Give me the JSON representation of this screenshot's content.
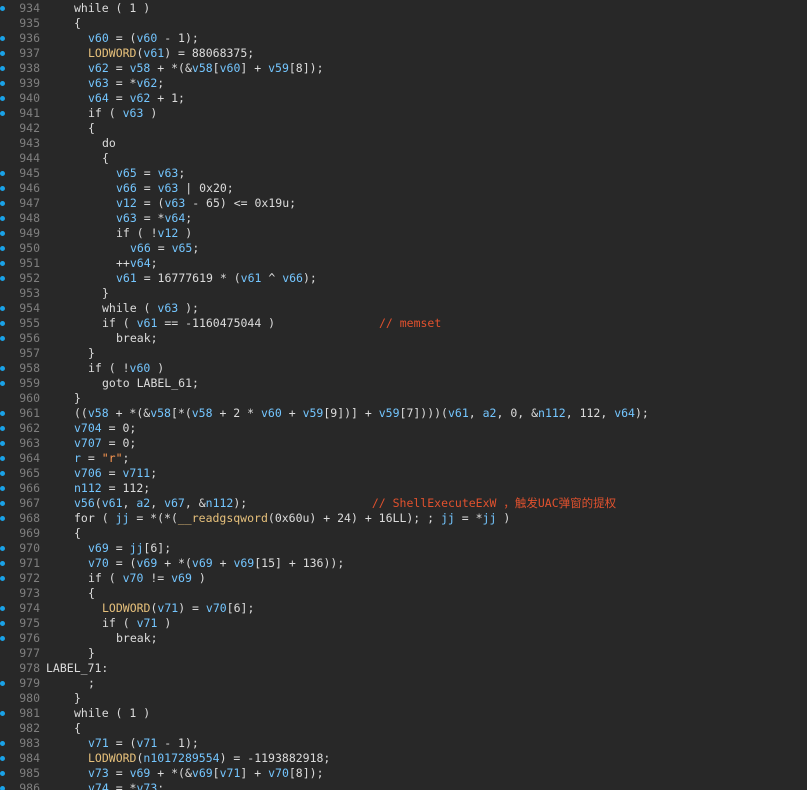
{
  "editor": {
    "lines": [
      {
        "n": "934",
        "dot": true,
        "indent": 2,
        "tokens": [
          [
            "k",
            "while ( 1 )"
          ]
        ]
      },
      {
        "n": "935",
        "dot": false,
        "indent": 2,
        "tokens": [
          [
            "k",
            "{"
          ]
        ]
      },
      {
        "n": "936",
        "dot": true,
        "indent": 3,
        "tokens": [
          [
            "v",
            "v60"
          ],
          [
            "k",
            " = ("
          ],
          [
            "v",
            "v60"
          ],
          [
            "k",
            " - 1);"
          ]
        ]
      },
      {
        "n": "937",
        "dot": true,
        "indent": 3,
        "tokens": [
          [
            "m",
            "LODWORD"
          ],
          [
            "k",
            "("
          ],
          [
            "v",
            "v61"
          ],
          [
            "k",
            ") = 88068375;"
          ]
        ]
      },
      {
        "n": "938",
        "dot": true,
        "indent": 3,
        "tokens": [
          [
            "v",
            "v62"
          ],
          [
            "k",
            " = "
          ],
          [
            "v",
            "v58"
          ],
          [
            "k",
            " + *(&"
          ],
          [
            "v",
            "v58"
          ],
          [
            "k",
            "["
          ],
          [
            "v",
            "v60"
          ],
          [
            "k",
            "] + "
          ],
          [
            "v",
            "v59"
          ],
          [
            "k",
            "[8]);"
          ]
        ]
      },
      {
        "n": "939",
        "dot": true,
        "indent": 3,
        "tokens": [
          [
            "v",
            "v63"
          ],
          [
            "k",
            " = *"
          ],
          [
            "v",
            "v62"
          ],
          [
            "k",
            ";"
          ]
        ]
      },
      {
        "n": "940",
        "dot": true,
        "indent": 3,
        "tokens": [
          [
            "v",
            "v64"
          ],
          [
            "k",
            " = "
          ],
          [
            "v",
            "v62"
          ],
          [
            "k",
            " + 1;"
          ]
        ]
      },
      {
        "n": "941",
        "dot": true,
        "indent": 3,
        "tokens": [
          [
            "k",
            "if ( "
          ],
          [
            "v",
            "v63"
          ],
          [
            "k",
            " )"
          ]
        ]
      },
      {
        "n": "942",
        "dot": false,
        "indent": 3,
        "tokens": [
          [
            "k",
            "{"
          ]
        ]
      },
      {
        "n": "943",
        "dot": false,
        "indent": 4,
        "tokens": [
          [
            "k",
            "do"
          ]
        ]
      },
      {
        "n": "944",
        "dot": false,
        "indent": 4,
        "tokens": [
          [
            "k",
            "{"
          ]
        ]
      },
      {
        "n": "945",
        "dot": true,
        "indent": 5,
        "tokens": [
          [
            "v",
            "v65"
          ],
          [
            "k",
            " = "
          ],
          [
            "v",
            "v63"
          ],
          [
            "k",
            ";"
          ]
        ]
      },
      {
        "n": "946",
        "dot": true,
        "indent": 5,
        "tokens": [
          [
            "v",
            "v66"
          ],
          [
            "k",
            " = "
          ],
          [
            "v",
            "v63"
          ],
          [
            "k",
            " | 0x20;"
          ]
        ]
      },
      {
        "n": "947",
        "dot": true,
        "indent": 5,
        "tokens": [
          [
            "v",
            "v12"
          ],
          [
            "k",
            " = ("
          ],
          [
            "v",
            "v63"
          ],
          [
            "k",
            " - 65) <= 0x19u;"
          ]
        ]
      },
      {
        "n": "948",
        "dot": true,
        "indent": 5,
        "tokens": [
          [
            "v",
            "v63"
          ],
          [
            "k",
            " = *"
          ],
          [
            "v",
            "v64"
          ],
          [
            "k",
            ";"
          ]
        ]
      },
      {
        "n": "949",
        "dot": true,
        "indent": 5,
        "tokens": [
          [
            "k",
            "if ( !"
          ],
          [
            "v",
            "v12"
          ],
          [
            "k",
            " )"
          ]
        ]
      },
      {
        "n": "950",
        "dot": true,
        "indent": 6,
        "tokens": [
          [
            "v",
            "v66"
          ],
          [
            "k",
            " = "
          ],
          [
            "v",
            "v65"
          ],
          [
            "k",
            ";"
          ]
        ]
      },
      {
        "n": "951",
        "dot": true,
        "indent": 5,
        "tokens": [
          [
            "k",
            "++"
          ],
          [
            "v",
            "v64"
          ],
          [
            "k",
            ";"
          ]
        ]
      },
      {
        "n": "952",
        "dot": true,
        "indent": 5,
        "tokens": [
          [
            "v",
            "v61"
          ],
          [
            "k",
            " = 16777619 * ("
          ],
          [
            "v",
            "v61"
          ],
          [
            "k",
            " ^ "
          ],
          [
            "v",
            "v66"
          ],
          [
            "k",
            ");"
          ]
        ]
      },
      {
        "n": "953",
        "dot": false,
        "indent": 4,
        "tokens": [
          [
            "k",
            "}"
          ]
        ]
      },
      {
        "n": "954",
        "dot": true,
        "indent": 4,
        "tokens": [
          [
            "k",
            "while ( "
          ],
          [
            "v",
            "v63"
          ],
          [
            "k",
            " );"
          ]
        ]
      },
      {
        "n": "955",
        "dot": true,
        "indent": 4,
        "tokens": [
          [
            "k",
            "if ( "
          ],
          [
            "v",
            "v61"
          ],
          [
            "k",
            " == -1160475044 )               "
          ],
          [
            "c",
            "// memset"
          ]
        ]
      },
      {
        "n": "956",
        "dot": true,
        "indent": 5,
        "tokens": [
          [
            "k",
            "break;"
          ]
        ]
      },
      {
        "n": "957",
        "dot": false,
        "indent": 3,
        "tokens": [
          [
            "k",
            "}"
          ]
        ]
      },
      {
        "n": "958",
        "dot": true,
        "indent": 3,
        "tokens": [
          [
            "k",
            "if ( !"
          ],
          [
            "v",
            "v60"
          ],
          [
            "k",
            " )"
          ]
        ]
      },
      {
        "n": "959",
        "dot": true,
        "indent": 4,
        "tokens": [
          [
            "k",
            "goto LABEL_61;"
          ]
        ]
      },
      {
        "n": "960",
        "dot": false,
        "indent": 2,
        "tokens": [
          [
            "k",
            "}"
          ]
        ]
      },
      {
        "n": "961",
        "dot": true,
        "indent": 2,
        "tokens": [
          [
            "k",
            "(("
          ],
          [
            "v",
            "v58"
          ],
          [
            "k",
            " + *(&"
          ],
          [
            "v",
            "v58"
          ],
          [
            "k",
            "[*("
          ],
          [
            "v",
            "v58"
          ],
          [
            "k",
            " + 2 * "
          ],
          [
            "v",
            "v60"
          ],
          [
            "k",
            " + "
          ],
          [
            "v",
            "v59"
          ],
          [
            "k",
            "[9])] + "
          ],
          [
            "v",
            "v59"
          ],
          [
            "k",
            "[7])))("
          ],
          [
            "v",
            "v61"
          ],
          [
            "k",
            ", "
          ],
          [
            "v",
            "a2"
          ],
          [
            "k",
            ", 0, &"
          ],
          [
            "v",
            "n112"
          ],
          [
            "k",
            ", 112, "
          ],
          [
            "v",
            "v64"
          ],
          [
            "k",
            ");"
          ]
        ]
      },
      {
        "n": "962",
        "dot": true,
        "indent": 2,
        "tokens": [
          [
            "v",
            "v704"
          ],
          [
            "k",
            " = 0;"
          ]
        ]
      },
      {
        "n": "963",
        "dot": true,
        "indent": 2,
        "tokens": [
          [
            "v",
            "v707"
          ],
          [
            "k",
            " = 0;"
          ]
        ]
      },
      {
        "n": "964",
        "dot": true,
        "indent": 2,
        "tokens": [
          [
            "v",
            "r"
          ],
          [
            "k",
            " = "
          ],
          [
            "s",
            "\"r\""
          ],
          [
            "k",
            ";"
          ]
        ]
      },
      {
        "n": "965",
        "dot": true,
        "indent": 2,
        "tokens": [
          [
            "v",
            "v706"
          ],
          [
            "k",
            " = "
          ],
          [
            "v",
            "v711"
          ],
          [
            "k",
            ";"
          ]
        ]
      },
      {
        "n": "966",
        "dot": true,
        "indent": 2,
        "tokens": [
          [
            "v",
            "n112"
          ],
          [
            "k",
            " = 112;"
          ]
        ]
      },
      {
        "n": "967",
        "dot": true,
        "indent": 2,
        "tokens": [
          [
            "v",
            "v56"
          ],
          [
            "k",
            "("
          ],
          [
            "v",
            "v61"
          ],
          [
            "k",
            ", "
          ],
          [
            "v",
            "a2"
          ],
          [
            "k",
            ", "
          ],
          [
            "v",
            "v67"
          ],
          [
            "k",
            ", &"
          ],
          [
            "v",
            "n112"
          ],
          [
            "k",
            ");                  "
          ],
          [
            "c",
            "// ShellExecuteExW ，触发UAC弹窗的提权"
          ]
        ]
      },
      {
        "n": "968",
        "dot": true,
        "indent": 2,
        "tokens": [
          [
            "k",
            "for ( "
          ],
          [
            "v",
            "jj"
          ],
          [
            "k",
            " = *(*("
          ],
          [
            "f",
            "__readgsqword"
          ],
          [
            "k",
            "(0x60u) + 24) + 16LL); ; "
          ],
          [
            "v",
            "jj"
          ],
          [
            "k",
            " = *"
          ],
          [
            "v",
            "jj"
          ],
          [
            "k",
            " )"
          ]
        ]
      },
      {
        "n": "969",
        "dot": false,
        "indent": 2,
        "tokens": [
          [
            "k",
            "{"
          ]
        ]
      },
      {
        "n": "970",
        "dot": true,
        "indent": 3,
        "tokens": [
          [
            "v",
            "v69"
          ],
          [
            "k",
            " = "
          ],
          [
            "v",
            "jj"
          ],
          [
            "k",
            "[6];"
          ]
        ]
      },
      {
        "n": "971",
        "dot": true,
        "indent": 3,
        "tokens": [
          [
            "v",
            "v70"
          ],
          [
            "k",
            " = ("
          ],
          [
            "v",
            "v69"
          ],
          [
            "k",
            " + *("
          ],
          [
            "v",
            "v69"
          ],
          [
            "k",
            " + "
          ],
          [
            "v",
            "v69"
          ],
          [
            "k",
            "[15] + 136));"
          ]
        ]
      },
      {
        "n": "972",
        "dot": true,
        "indent": 3,
        "tokens": [
          [
            "k",
            "if ( "
          ],
          [
            "v",
            "v70"
          ],
          [
            "k",
            " != "
          ],
          [
            "v",
            "v69"
          ],
          [
            "k",
            " )"
          ]
        ]
      },
      {
        "n": "973",
        "dot": false,
        "indent": 3,
        "tokens": [
          [
            "k",
            "{"
          ]
        ]
      },
      {
        "n": "974",
        "dot": true,
        "indent": 4,
        "tokens": [
          [
            "m",
            "LODWORD"
          ],
          [
            "k",
            "("
          ],
          [
            "v",
            "v71"
          ],
          [
            "k",
            ") = "
          ],
          [
            "v",
            "v70"
          ],
          [
            "k",
            "[6];"
          ]
        ]
      },
      {
        "n": "975",
        "dot": true,
        "indent": 4,
        "tokens": [
          [
            "k",
            "if ( "
          ],
          [
            "v",
            "v71"
          ],
          [
            "k",
            " )"
          ]
        ]
      },
      {
        "n": "976",
        "dot": true,
        "indent": 5,
        "tokens": [
          [
            "k",
            "break;"
          ]
        ]
      },
      {
        "n": "977",
        "dot": false,
        "indent": 3,
        "tokens": [
          [
            "k",
            "}"
          ]
        ]
      },
      {
        "n": "978",
        "dot": false,
        "indent": 0,
        "tokens": [
          [
            "k",
            "LABEL_71:"
          ]
        ]
      },
      {
        "n": "979",
        "dot": true,
        "indent": 3,
        "tokens": [
          [
            "k",
            ";"
          ]
        ]
      },
      {
        "n": "980",
        "dot": false,
        "indent": 2,
        "tokens": [
          [
            "k",
            "}"
          ]
        ]
      },
      {
        "n": "981",
        "dot": true,
        "indent": 2,
        "tokens": [
          [
            "k",
            "while ( 1 )"
          ]
        ]
      },
      {
        "n": "982",
        "dot": false,
        "indent": 2,
        "tokens": [
          [
            "k",
            "{"
          ]
        ]
      },
      {
        "n": "983",
        "dot": true,
        "indent": 3,
        "tokens": [
          [
            "v",
            "v71"
          ],
          [
            "k",
            " = ("
          ],
          [
            "v",
            "v71"
          ],
          [
            "k",
            " - 1);"
          ]
        ]
      },
      {
        "n": "984",
        "dot": true,
        "indent": 3,
        "tokens": [
          [
            "m",
            "LODWORD"
          ],
          [
            "k",
            "("
          ],
          [
            "v",
            "n1017289554"
          ],
          [
            "k",
            ") = -1193882918;"
          ]
        ]
      },
      {
        "n": "985",
        "dot": true,
        "indent": 3,
        "tokens": [
          [
            "v",
            "v73"
          ],
          [
            "k",
            " = "
          ],
          [
            "v",
            "v69"
          ],
          [
            "k",
            " + *(&"
          ],
          [
            "v",
            "v69"
          ],
          [
            "k",
            "["
          ],
          [
            "v",
            "v71"
          ],
          [
            "k",
            "] + "
          ],
          [
            "v",
            "v70"
          ],
          [
            "k",
            "[8]);"
          ]
        ]
      },
      {
        "n": "986",
        "dot": true,
        "indent": 3,
        "tokens": [
          [
            "v",
            "v74"
          ],
          [
            "k",
            " = *"
          ],
          [
            "v",
            "v73"
          ],
          [
            "k",
            ";"
          ]
        ]
      }
    ]
  },
  "colors": {
    "background": "#282828",
    "line_number": "#7f7f7f",
    "breakpoint_dot": "#1aa3e8",
    "plain_text": "#dcdcdc",
    "variable": "#74c6ff",
    "macro": "#e6c07b",
    "comment": "#e0512e",
    "string": "#ff9a52"
  }
}
